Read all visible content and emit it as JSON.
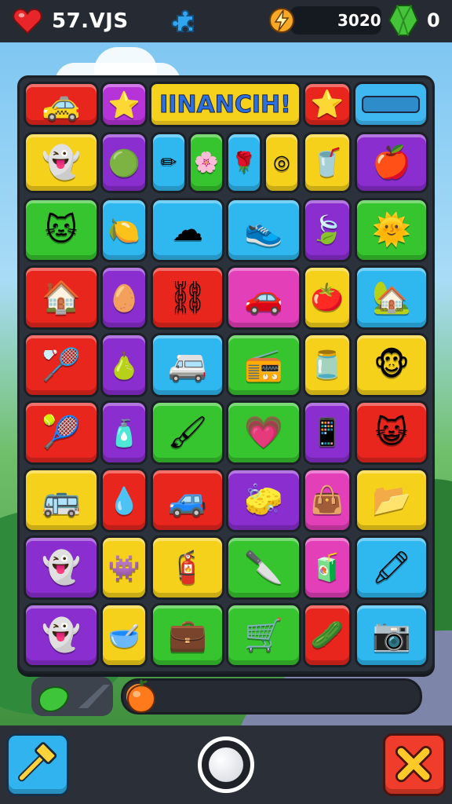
{
  "hud": {
    "lives_label": "57.VJS",
    "score": "3020",
    "gems": "0",
    "icons": [
      "heart-icon",
      "puzzle-icon",
      "lightning-icon",
      "gem-icon"
    ]
  },
  "board": {
    "title": "IINANCIH!",
    "tiles": [
      {
        "color": "#e8261e",
        "icon": "car-icon",
        "glyph": "🚕"
      },
      {
        "color": "#b633d8",
        "icon": "star-icon",
        "glyph": "⭐"
      },
      {
        "color": "#e8261e",
        "icon": "star-icon",
        "glyph": "⭐"
      },
      {
        "color": "#f6d11c",
        "icon": "ghost-icon",
        "glyph": "👻"
      },
      {
        "color": "#8a2ed0",
        "icon": "balloon-icon",
        "glyph": "🟢"
      },
      {
        "color": "#2fb8f0",
        "icon": "pencil-icon",
        "glyph": "✏"
      },
      {
        "color": "#36c52e",
        "icon": "flower-icon",
        "glyph": "🌸"
      },
      {
        "color": "#2fb8f0",
        "icon": "rose-icon",
        "glyph": "🌹"
      },
      {
        "color": "#f6d11c",
        "icon": "tape-icon",
        "glyph": "◎"
      },
      {
        "color": "#f6d11c",
        "icon": "cup-icon",
        "glyph": "🥤"
      },
      {
        "color": "#8a2ed0",
        "icon": "fruit-icon",
        "glyph": "🍎"
      },
      {
        "color": "#36c52e",
        "icon": "cat-icon",
        "glyph": "🐱"
      },
      {
        "color": "#2fb8f0",
        "icon": "lemon-icon",
        "glyph": "🍋"
      },
      {
        "color": "#2fb8f0",
        "icon": "cloud-icon",
        "glyph": "☁"
      },
      {
        "color": "#2fb8f0",
        "icon": "shoe-icon",
        "glyph": "👟"
      },
      {
        "color": "#8a2ed0",
        "icon": "leaf-icon",
        "glyph": "🍃"
      },
      {
        "color": "#36c52e",
        "icon": "sun-icon",
        "glyph": "🌞"
      },
      {
        "color": "#e8261e",
        "icon": "house-icon",
        "glyph": "🏠"
      },
      {
        "color": "#8a2ed0",
        "icon": "egg-icon",
        "glyph": "🥚"
      },
      {
        "color": "#e8261e",
        "icon": "handcuffs-icon",
        "glyph": "⛓"
      },
      {
        "color": "#e23fb8",
        "icon": "car-icon",
        "glyph": "🚗"
      },
      {
        "color": "#f6d11c",
        "icon": "tomato-icon",
        "glyph": "🍅"
      },
      {
        "color": "#2fb8f0",
        "icon": "home-icon",
        "glyph": "🏡"
      },
      {
        "color": "#e8261e",
        "icon": "racket-icon",
        "glyph": "🏸"
      },
      {
        "color": "#8a2ed0",
        "icon": "pear-icon",
        "glyph": "🍐"
      },
      {
        "color": "#2fb8f0",
        "icon": "van-icon",
        "glyph": "🚐"
      },
      {
        "color": "#36c52e",
        "icon": "radio-icon",
        "glyph": "📻"
      },
      {
        "color": "#f6d11c",
        "icon": "jar-icon",
        "glyph": "🫙"
      },
      {
        "color": "#f6d11c",
        "icon": "monkey-icon",
        "glyph": "🐵"
      },
      {
        "color": "#e8261e",
        "icon": "tennis-racket-icon",
        "glyph": "🎾"
      },
      {
        "color": "#8a2ed0",
        "icon": "bottle-icon",
        "glyph": "🧴"
      },
      {
        "color": "#36c52e",
        "icon": "brush-icon",
        "glyph": "🖌"
      },
      {
        "color": "#36c52e",
        "icon": "heart-icon",
        "glyph": "💗"
      },
      {
        "color": "#8a2ed0",
        "icon": "phone-icon",
        "glyph": "📱"
      },
      {
        "color": "#e8261e",
        "icon": "cat-face-icon",
        "glyph": "😺"
      },
      {
        "color": "#f6d11c",
        "icon": "bus-icon",
        "glyph": "🚌"
      },
      {
        "color": "#e8261e",
        "icon": "drop-icon",
        "glyph": "💧"
      },
      {
        "color": "#e8261e",
        "icon": "car-icon",
        "glyph": "🚙"
      },
      {
        "color": "#8a2ed0",
        "icon": "eraser-icon",
        "glyph": "🧽"
      },
      {
        "color": "#e23fb8",
        "icon": "bag-icon",
        "glyph": "👜"
      },
      {
        "color": "#f6d11c",
        "icon": "folder-icon",
        "glyph": "📂"
      },
      {
        "color": "#8a2ed0",
        "icon": "ghost-icon",
        "glyph": "👻"
      },
      {
        "color": "#f6d11c",
        "icon": "ghost-icon",
        "glyph": "👾"
      },
      {
        "color": "#f6d11c",
        "icon": "roller-icon",
        "glyph": "🧯"
      },
      {
        "color": "#36c52e",
        "icon": "knife-icon",
        "glyph": "🔪"
      },
      {
        "color": "#e23fb8",
        "icon": "jar-icon",
        "glyph": "🧃"
      },
      {
        "color": "#2fb8f0",
        "icon": "crayon-icon",
        "glyph": "🖍"
      },
      {
        "color": "#8a2ed0",
        "icon": "ghost-icon",
        "glyph": "👻"
      },
      {
        "color": "#f6d11c",
        "icon": "bowl-icon",
        "glyph": "🥣"
      },
      {
        "color": "#36c52e",
        "icon": "case-icon",
        "glyph": "💼"
      },
      {
        "color": "#36c52e",
        "icon": "cart-icon",
        "glyph": "🛒"
      },
      {
        "color": "#e8261e",
        "icon": "pepper-icon",
        "glyph": "🥒"
      },
      {
        "color": "#2fb8f0",
        "icon": "camera-icon",
        "glyph": "📷"
      }
    ]
  },
  "progress": {
    "value": 0.04,
    "icons": [
      "bean-icon",
      "orange-icon"
    ]
  },
  "controls": {
    "left_icon": "hammer-icon",
    "center_icon": "shuffle-button-icon",
    "right_icon": "close-icon"
  }
}
